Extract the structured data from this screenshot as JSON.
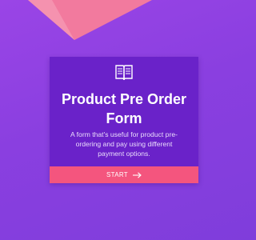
{
  "colors": {
    "background": "#8a3fe0",
    "card": "#6a22c9",
    "accent": "#f4557e",
    "top_shape": "#f27a9e"
  },
  "card": {
    "icon": "book-icon",
    "title": "Product Pre Order Form",
    "description": "A form that's useful for product pre-ordering and pay using different payment options.",
    "button_label": "START",
    "button_icon": "arrow-right-icon"
  }
}
